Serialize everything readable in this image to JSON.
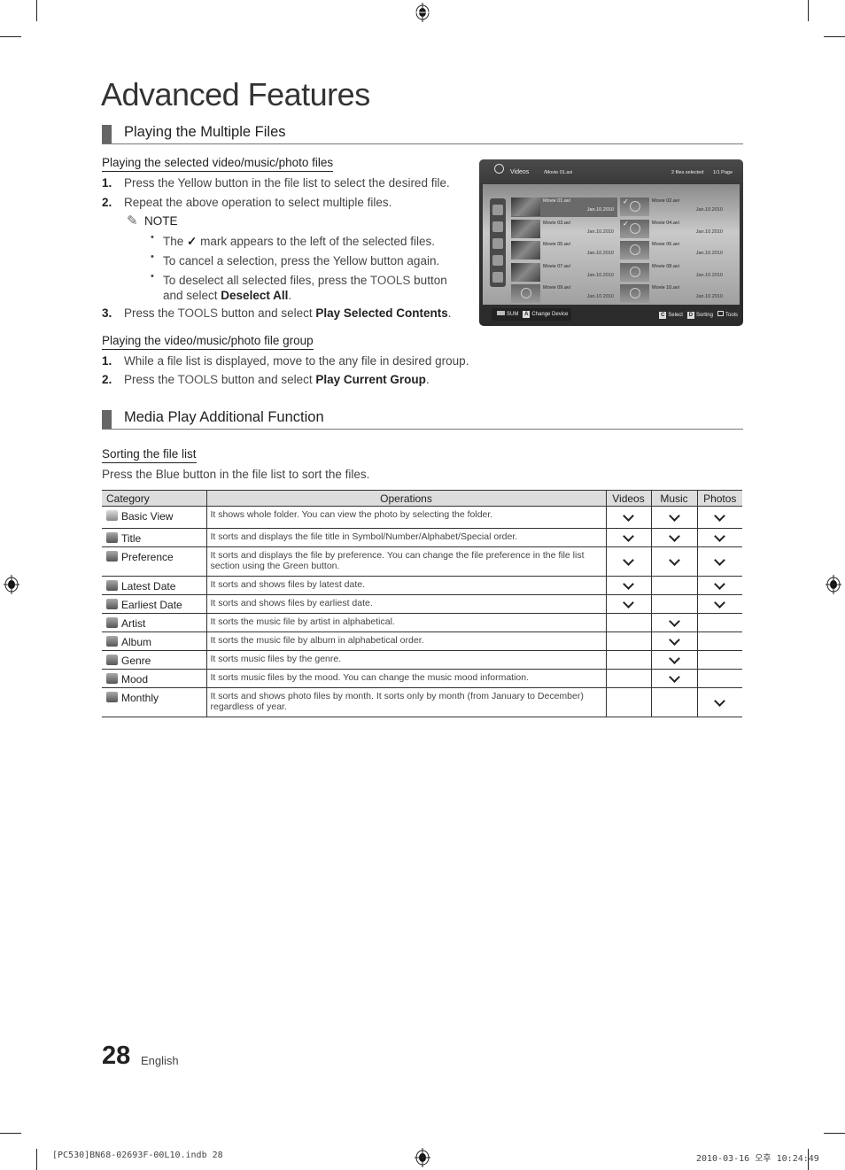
{
  "page_title": "Advanced Features",
  "section1": {
    "title": "Playing the Multiple Files",
    "sub1": {
      "title": "Playing the selected video/music/photo files",
      "steps": [
        {
          "num": "1.",
          "text": "Press the Yellow button in the file list to select the desired file."
        },
        {
          "num": "2.",
          "text": "Repeat the above operation to select multiple files."
        },
        {
          "num": "3.",
          "pre": "Press the ",
          "kw": "TOOLS",
          "mid": " button and select ",
          "bold": "Play Selected Contents",
          "post": "."
        }
      ],
      "note": {
        "label": "NOTE",
        "bullets": [
          {
            "pre": "The ",
            "post": " mark appears to the left of the selected files."
          },
          {
            "text": "To cancel a selection, press the Yellow button again."
          },
          {
            "pre": "To deselect all selected files, press the ",
            "kw": "TOOLS",
            "mid": " button",
            "line2": "and select ",
            "bold": "Deselect All",
            "post": "."
          }
        ]
      }
    },
    "sub2": {
      "title": "Playing the video/music/photo file group",
      "steps": [
        {
          "num": "1.",
          "text": "While a file list is displayed, move to the any file in desired group."
        },
        {
          "num": "2.",
          "pre": "Press the ",
          "kw": "TOOLS",
          "mid": " button and select ",
          "bold": "Play Current Group",
          "post": "."
        }
      ]
    }
  },
  "tv_screen": {
    "category": "Videos",
    "path": "/Movie 01.avi",
    "selected_count": "2 files selected",
    "page": "1/1 Page",
    "files": [
      {
        "name": "Movie 01.avi",
        "date": "Jan.10.2010",
        "checked": false,
        "focused": true
      },
      {
        "name": "Movie 02.avi",
        "date": "Jan.10.2010",
        "checked": true
      },
      {
        "name": "Movie 03.avi",
        "date": "Jan.10.2010",
        "checked": false
      },
      {
        "name": "Movie 04.avi",
        "date": "Jan.10.2010",
        "checked": true
      },
      {
        "name": "Movie 05.avi",
        "date": "Jan.10.2010",
        "checked": false
      },
      {
        "name": "Movie 06.avi",
        "date": "Jan.10.2010",
        "checked": false
      },
      {
        "name": "Movie 07.avi",
        "date": "Jan.10.2010",
        "checked": false
      },
      {
        "name": "Movie 08.avi",
        "date": "Jan.10.2010",
        "checked": false
      },
      {
        "name": "Movie 09.avi",
        "date": "Jan.10.2010",
        "checked": false
      },
      {
        "name": "Movie 10.avi",
        "date": "Jan.10.2010",
        "checked": false
      }
    ],
    "bottom_left": {
      "sum": "SUM",
      "key_a": "A",
      "change_device": "Change Device"
    },
    "bottom_right": {
      "key_c": "C",
      "select": "Select",
      "key_d": "D",
      "sorting": "Sorting",
      "tools": "Tools"
    }
  },
  "section2": {
    "title": "Media Play Additional Function",
    "sub1": {
      "title": "Sorting the file list",
      "intro": "Press the Blue button in the file list to sort the files."
    }
  },
  "table": {
    "headers": [
      "Category",
      "Operations",
      "Videos",
      "Music",
      "Photos"
    ],
    "rows": [
      {
        "icon": "folder-icon",
        "category": "Basic View",
        "operation": "It shows whole folder. You can view the photo by selecting the folder.",
        "videos": true,
        "music": true,
        "photos": true
      },
      {
        "icon": "title-sort-icon",
        "category": "Title",
        "operation": "It sorts and displays the file title in Symbol/Number/Alphabet/Special order.",
        "videos": true,
        "music": true,
        "photos": true
      },
      {
        "icon": "star-icon",
        "category": "Preference",
        "operation": "It sorts and displays the file by preference. You can change the file preference in the file list section using the Green button.",
        "videos": true,
        "music": true,
        "photos": true
      },
      {
        "icon": "calendar-latest-icon",
        "category": "Latest Date",
        "operation": "It sorts and shows files by latest date.",
        "videos": true,
        "music": false,
        "photos": true
      },
      {
        "icon": "calendar-earliest-icon",
        "category": "Earliest Date",
        "operation": "It sorts and shows files by earliest date.",
        "videos": true,
        "music": false,
        "photos": true
      },
      {
        "icon": "artist-icon",
        "category": "Artist",
        "operation": "It sorts the music file by artist in alphabetical.",
        "videos": false,
        "music": true,
        "photos": false
      },
      {
        "icon": "album-icon",
        "category": "Album",
        "operation": "It sorts the music file by album in alphabetical order.",
        "videos": false,
        "music": true,
        "photos": false
      },
      {
        "icon": "genre-icon",
        "category": "Genre",
        "operation": "It sorts music files by the genre.",
        "videos": false,
        "music": true,
        "photos": false
      },
      {
        "icon": "mood-icon",
        "category": "Mood",
        "operation": "It sorts music files by the mood. You can change the music mood information.",
        "videos": false,
        "music": true,
        "photos": false
      },
      {
        "icon": "calendar-monthly-icon",
        "category": "Monthly",
        "operation": "It sorts and shows photo files by month. It sorts only by month (from January to December) regardless of year.",
        "videos": false,
        "music": false,
        "photos": true
      }
    ]
  },
  "footer": {
    "page_number": "28",
    "language": "English"
  },
  "slug": {
    "left": "[PC530]BN68-02693F-00L10.indb   28",
    "right": "2010-03-16   오후 10:24:49"
  }
}
